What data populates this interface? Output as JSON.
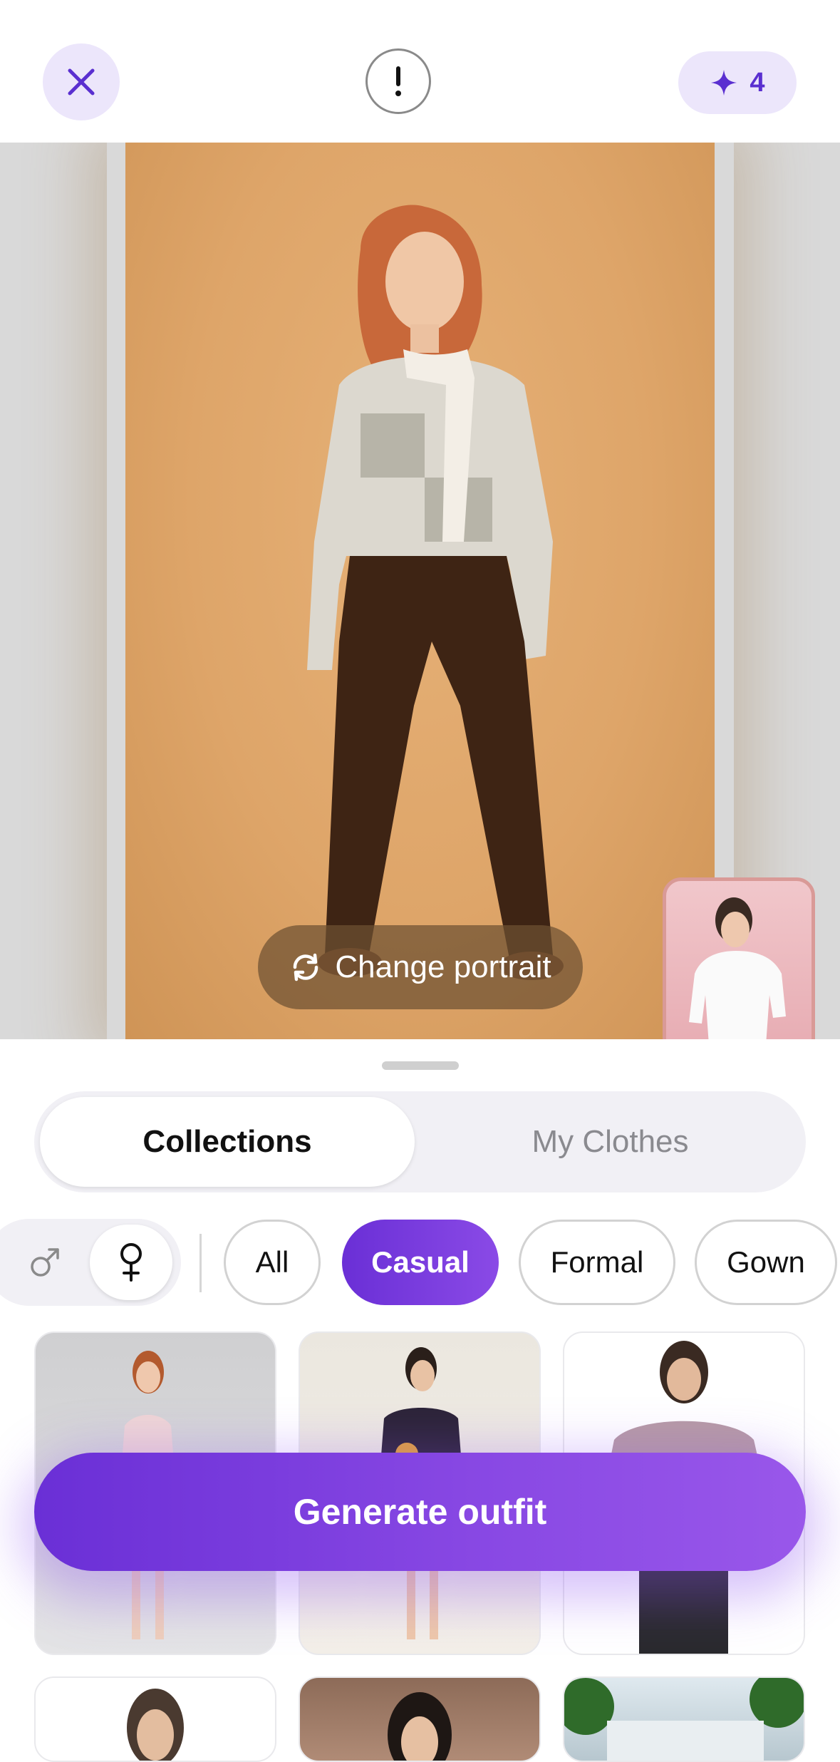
{
  "header": {
    "close_icon": "close-icon",
    "info_icon": "exclamation-icon",
    "credits": {
      "icon": "sparkle-icon",
      "count": "4"
    }
  },
  "portrait": {
    "change_label": "Change portrait",
    "change_icon": "refresh-icon"
  },
  "tabs": {
    "collections": "Collections",
    "my_clothes": "My Clothes",
    "active": "Collections"
  },
  "gender": {
    "male_icon": "male-symbol-icon",
    "female_icon": "female-symbol-icon",
    "selected": "female"
  },
  "filters": {
    "items": [
      "All",
      "Casual",
      "Formal",
      "Gown"
    ],
    "selected": "Casual"
  },
  "cta": {
    "label": "Generate outfit"
  },
  "colors": {
    "accent": "#6a2fd6",
    "accent_light": "#ece6fb"
  }
}
